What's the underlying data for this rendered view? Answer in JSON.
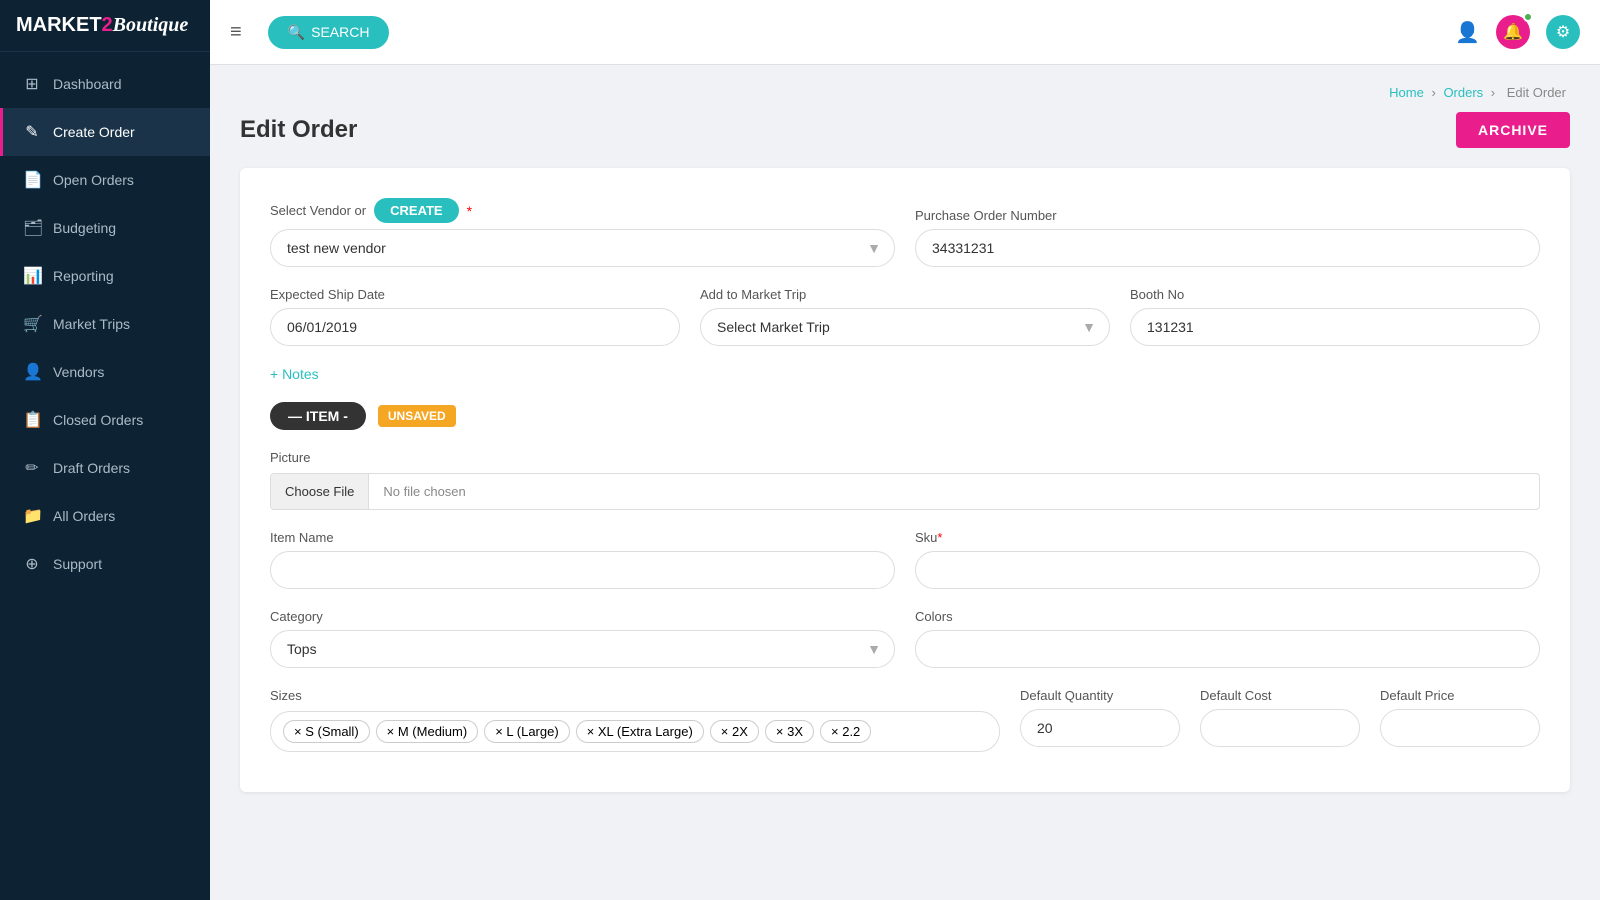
{
  "sidebar": {
    "logo": "MARKET2Boutique",
    "items": [
      {
        "id": "dashboard",
        "label": "Dashboard",
        "icon": "⊞",
        "active": false
      },
      {
        "id": "create-order",
        "label": "Create Order",
        "icon": "✎",
        "active": true
      },
      {
        "id": "open-orders",
        "label": "Open Orders",
        "icon": "📄",
        "active": false
      },
      {
        "id": "budgeting",
        "label": "Budgeting",
        "icon": "🗂",
        "active": false
      },
      {
        "id": "reporting",
        "label": "Reporting",
        "icon": "📊",
        "active": false
      },
      {
        "id": "market-trips",
        "label": "Market Trips",
        "icon": "🛒",
        "active": false
      },
      {
        "id": "vendors",
        "label": "Vendors",
        "icon": "👤",
        "active": false
      },
      {
        "id": "closed-orders",
        "label": "Closed Orders",
        "icon": "📋",
        "active": false
      },
      {
        "id": "draft-orders",
        "label": "Draft Orders",
        "icon": "✏",
        "active": false
      },
      {
        "id": "all-orders",
        "label": "All Orders",
        "icon": "📁",
        "active": false
      },
      {
        "id": "support",
        "label": "Support",
        "icon": "⊕",
        "active": false
      }
    ]
  },
  "topbar": {
    "search_label": "SEARCH",
    "hamburger": "≡"
  },
  "breadcrumb": {
    "home": "Home",
    "orders": "Orders",
    "current": "Edit Order"
  },
  "page": {
    "title": "Edit Order",
    "archive_btn": "ARCHIVE"
  },
  "form": {
    "vendor_label": "Select Vendor or",
    "create_btn": "CREATE",
    "vendor_value": "test new vendor",
    "po_label": "Purchase Order Number",
    "po_value": "34331231",
    "ship_date_label": "Expected Ship Date",
    "ship_date_value": "06/01/2019",
    "market_trip_label": "Add to Market Trip",
    "market_trip_placeholder": "Select Market Trip",
    "booth_label": "Booth No",
    "booth_value": "131231",
    "notes_label": "+ Notes",
    "item_badge": "— ITEM -",
    "unsaved_badge": "UNSAVED",
    "picture_label": "Picture",
    "choose_file_btn": "Choose File",
    "no_file_text": "No file chosen",
    "item_name_label": "Item Name",
    "sku_label": "Sku",
    "category_label": "Category",
    "category_value": "Tops",
    "colors_label": "Colors",
    "sizes_label": "Sizes",
    "sizes": [
      {
        "label": "× S (Small)"
      },
      {
        "label": "× M (Medium)"
      },
      {
        "label": "× L (Large)"
      },
      {
        "label": "× XL (Extra Large)"
      },
      {
        "label": "× 2X"
      },
      {
        "label": "× 3X"
      },
      {
        "label": "× 2.2"
      }
    ],
    "default_qty_label": "Default Quantity",
    "default_qty_value": "20",
    "default_cost_label": "Default Cost",
    "default_price_label": "Default Price"
  }
}
